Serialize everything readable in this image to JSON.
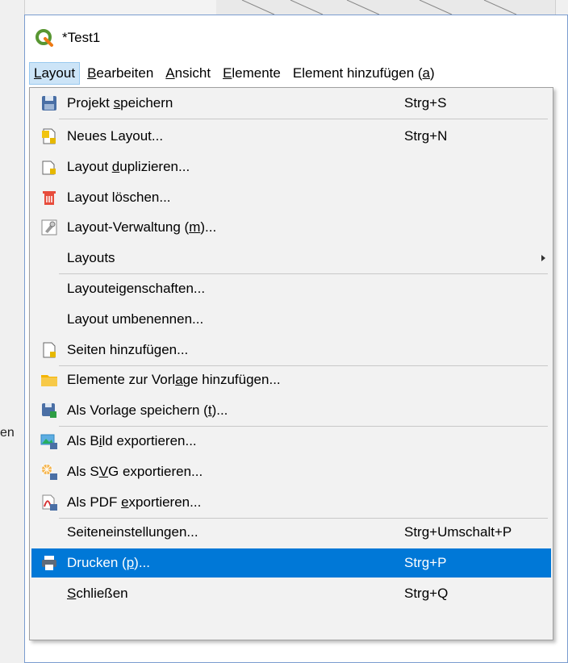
{
  "window": {
    "title": "*Test1"
  },
  "menubar": {
    "items": [
      {
        "pre": "",
        "u": "L",
        "post": "ayout",
        "active": true
      },
      {
        "pre": "",
        "u": "B",
        "post": "earbeiten"
      },
      {
        "pre": "",
        "u": "A",
        "post": "nsicht"
      },
      {
        "pre": "",
        "u": "E",
        "post": "lemente"
      },
      {
        "pre": "Element hinzufügen (",
        "u": "a",
        "post": ")"
      }
    ]
  },
  "background": {
    "stray_text": "en"
  },
  "menu": {
    "items": [
      {
        "icon": "save-project-icon",
        "pre": "Projekt ",
        "u": "s",
        "post": "peichern",
        "shortcut": "Strg+S"
      },
      {
        "icon": "new-layout-icon",
        "pre": "Neues Layout...",
        "u": "",
        "post": "",
        "shortcut": "Strg+N"
      },
      {
        "icon": "duplicate-layout-icon",
        "pre": "Layout ",
        "u": "d",
        "post": "uplizieren...",
        "shortcut": ""
      },
      {
        "icon": "delete-layout-icon",
        "pre": "Layout löschen...",
        "u": "",
        "post": "",
        "shortcut": ""
      },
      {
        "icon": "layout-manager-icon",
        "pre": "Layout-Verwaltung (",
        "u": "m",
        "post": ")...",
        "shortcut": ""
      },
      {
        "icon": "",
        "pre": "Layouts",
        "u": "",
        "post": "",
        "shortcut": "",
        "submenu": true
      },
      {
        "icon": "",
        "pre": "Layouteigenschaften...",
        "u": "",
        "post": "",
        "shortcut": ""
      },
      {
        "icon": "",
        "pre": "Layout umbenennen...",
        "u": "",
        "post": "",
        "shortcut": ""
      },
      {
        "icon": "add-pages-icon",
        "pre": "Seiten hinzufügen...",
        "u": "",
        "post": "",
        "shortcut": ""
      },
      {
        "icon": "folder-icon",
        "pre": "Elemente zur Vorl",
        "u": "a",
        "post": "ge hinzufügen...",
        "shortcut": ""
      },
      {
        "icon": "save-template-icon",
        "pre": "Als Vorlage speichern (",
        "u": "t",
        "post": ")...",
        "shortcut": ""
      },
      {
        "icon": "export-image-icon",
        "pre": "Als B",
        "u": "i",
        "post": "ld exportieren...",
        "shortcut": ""
      },
      {
        "icon": "export-svg-icon",
        "pre": "Als S",
        "u": "V",
        "post": "G exportieren...",
        "shortcut": ""
      },
      {
        "icon": "export-pdf-icon",
        "pre": "Als PDF ",
        "u": "e",
        "post": "xportieren...",
        "shortcut": ""
      },
      {
        "icon": "",
        "pre": "Seiteneinstellun",
        "u": "g",
        "post": "en...",
        "shortcut": "Strg+Umschalt+P"
      },
      {
        "icon": "print-icon",
        "pre": "Drucken (",
        "u": "p",
        "post": ")...",
        "shortcut": "Strg+P",
        "highlighted": true
      },
      {
        "icon": "",
        "pre": "",
        "u": "S",
        "post": "chließen",
        "shortcut": "Strg+Q"
      }
    ]
  }
}
